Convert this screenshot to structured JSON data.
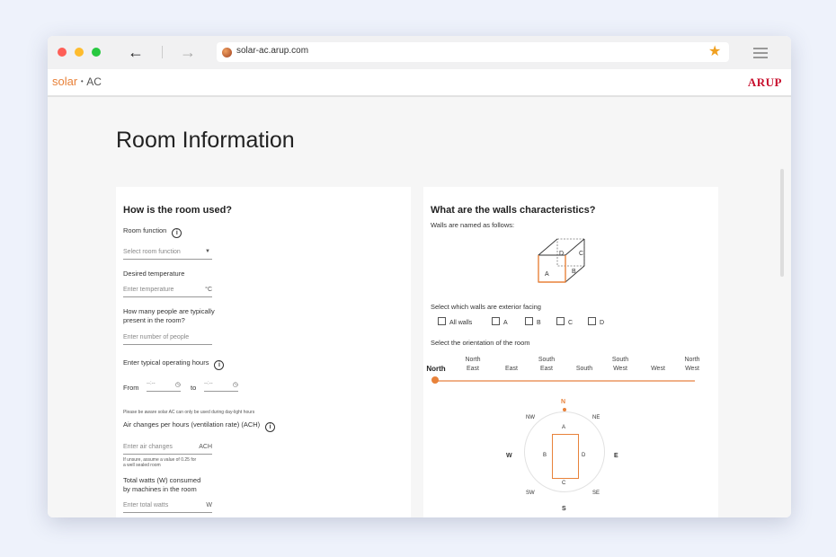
{
  "browser": {
    "url": "solar-ac.arup.com"
  },
  "app": {
    "logo_solar": "solar",
    "logo_dot": "•",
    "logo_ac": "AC",
    "brand": "ARUP"
  },
  "page": {
    "title": "Room Information"
  },
  "room_usage": {
    "title": "How is the room used?",
    "room_function_label": "Room function",
    "room_function_placeholder": "Select room function",
    "desired_temperature_label": "Desired temperature",
    "temperature_placeholder": "Enter temperature",
    "temperature_unit": "°C",
    "people_label_line1": "How many people are typically",
    "people_label_line2": "present in the room?",
    "people_placeholder": "Enter number of people",
    "hours_label": "Enter typical operating hours",
    "from_label": "From",
    "to_label": "to",
    "time_placeholder": "--:--",
    "daylight_note": "Please be aware solar AC can only be used during day-light hours",
    "ach_label": "Air changes per hours (ventilation rate) (ACH)",
    "ach_placeholder": "Enter air changes",
    "ach_unit": "ACH",
    "ach_hint_line1": "If unsure, assume a value of 0.25 for",
    "ach_hint_line2": "a well sealed room",
    "watts_label_line1": "Total watts (W) consumed",
    "watts_label_line2": "by machines in the room",
    "watts_placeholder": "Enter total watts",
    "watts_unit": "W"
  },
  "walls": {
    "title": "What are the walls characteristics?",
    "naming_label": "Walls are named as follows:",
    "cube_labels": [
      "A",
      "B",
      "C",
      "D"
    ],
    "exterior_label": "Select which walls are exterior facing",
    "checkboxes": [
      "All walls",
      "A",
      "B",
      "C",
      "D"
    ],
    "orientation_label": "Select the orientation of the room",
    "orientations": [
      [
        "North"
      ],
      [
        "North",
        "East"
      ],
      [
        "East"
      ],
      [
        "South",
        "East"
      ],
      [
        "South"
      ],
      [
        "South",
        "West"
      ],
      [
        "West"
      ],
      [
        "North",
        "West"
      ]
    ],
    "selected_orientation": "North",
    "compass": {
      "N": "N",
      "S": "S",
      "E": "E",
      "W": "W",
      "NE": "NE",
      "NW": "NW",
      "SE": "SE",
      "SW": "SW"
    },
    "room_walls": {
      "top": "A",
      "left": "B",
      "bottom": "C",
      "right": "D"
    }
  },
  "colors": {
    "accent": "#e8823a",
    "brand": "#c8102e"
  },
  "icons": [
    "back-arrow-icon",
    "forward-arrow-icon",
    "star-icon",
    "menu-icon",
    "info-icon",
    "chevron-down-icon",
    "clock-icon"
  ]
}
